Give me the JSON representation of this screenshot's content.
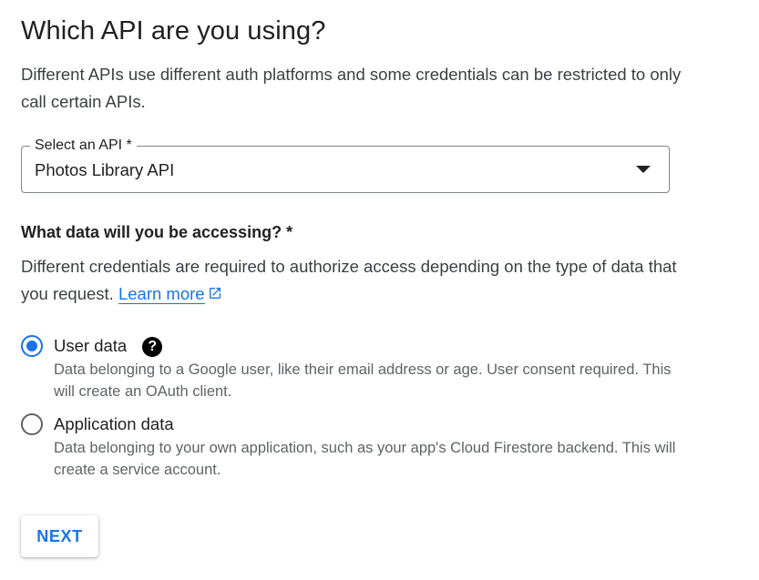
{
  "page": {
    "title": "Which API are you using?",
    "intro": "Different APIs use different auth platforms and some credentials can be restricted to only call certain APIs."
  },
  "api_select": {
    "label": "Select an API *",
    "value": "Photos Library API",
    "icon": "arrow-drop-down-icon"
  },
  "data_section": {
    "heading": "What data will you be accessing? *",
    "description": "Different credentials are required to authorize access depending on the type of data that you request.",
    "learn_more": "Learn more",
    "options": [
      {
        "label": "User data",
        "description": "Data belonging to a Google user, like their email address or age. User consent required. This will create an OAuth client.",
        "selected": true,
        "help_icon": "?"
      },
      {
        "label": "Application data",
        "description": "Data belonging to your own application, such as your app's Cloud Firestore backend. This will create a service account.",
        "selected": false
      }
    ]
  },
  "actions": {
    "next_label": "NEXT"
  },
  "colors": {
    "accent": "#1a73e8",
    "text_primary": "#202124",
    "text_secondary": "#5f6368",
    "border": "#80868b"
  }
}
